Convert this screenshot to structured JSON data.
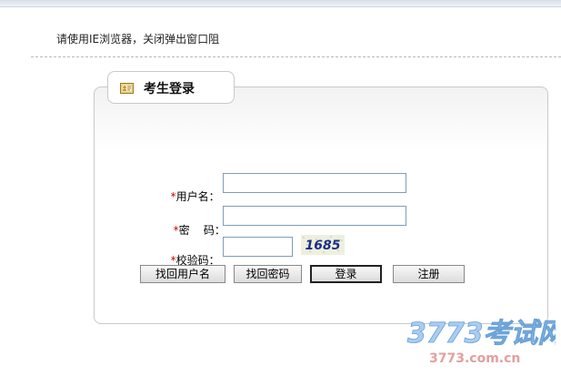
{
  "notice_text": "请使用IE浏览器，关闭弹出窗口阻",
  "panel": {
    "title": "考生登录",
    "icon": "certificate-icon"
  },
  "form": {
    "required_mark": "*",
    "username_label": "用户名：",
    "username_value": "",
    "password_label": "密    码：",
    "password_value": "",
    "captcha_label": "校验码：",
    "captcha_value": "",
    "captcha_code": "1685"
  },
  "buttons": {
    "retrieve_username": "找回用户名",
    "retrieve_password": "找回密码",
    "login": "登录",
    "register": "注册"
  },
  "watermark": {
    "brand": "3773考试网",
    "domain": "3773.com.cn"
  },
  "colors": {
    "required": "#cc0000",
    "watermark": "#7fb3e0",
    "captcha_text": "#1b2f8a"
  }
}
